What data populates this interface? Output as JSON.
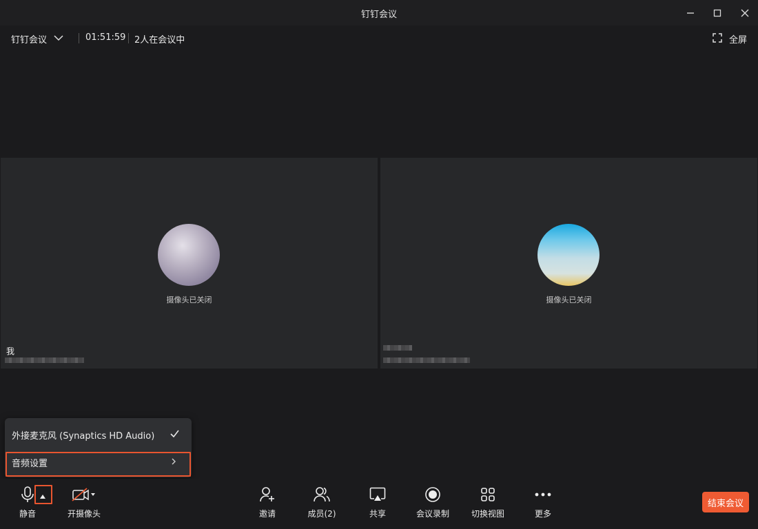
{
  "window": {
    "title": "钉钉会议"
  },
  "infobar": {
    "meeting_name": "钉钉会议",
    "duration": "01:51:59",
    "participants_text": "2人在会议中",
    "fullscreen_label": "全屏"
  },
  "tiles": [
    {
      "status": "摄像头已关闭",
      "name": "我",
      "avatar_colors": [
        "#b7afc0",
        "#d9d4dc",
        "#8f86a0"
      ]
    },
    {
      "status": "摄像头已关闭",
      "name": "",
      "avatar_colors": [
        "#2bb6e6",
        "#b9dbe8",
        "#e8c766"
      ]
    }
  ],
  "popup": {
    "device": "外接麦克风 (Synaptics HD Audio)",
    "audio_settings": "音频设置"
  },
  "toolbar": {
    "mute": "静音",
    "camera": "开摄像头",
    "invite": "邀请",
    "members": "成员(2)",
    "share": "共享",
    "record": "会议录制",
    "switch_view": "切换视图",
    "more": "更多",
    "end": "结束会议"
  },
  "colors": {
    "accent": "#ef5b33",
    "highlight": "#e9552f",
    "background": "#1b1b1d",
    "tile": "#27282a"
  }
}
